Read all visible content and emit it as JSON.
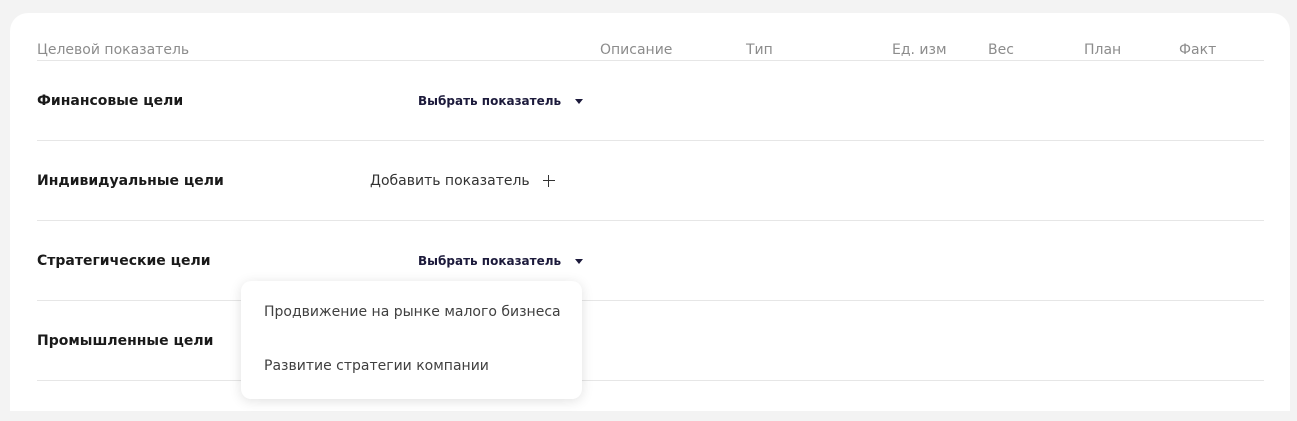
{
  "table": {
    "columns": {
      "indicator": "Целевой показатель",
      "description": "Описание",
      "type": "Тип",
      "unit": "Ед. изм",
      "weight": "Вес",
      "plan": "План",
      "fact": "Факт"
    },
    "rows": [
      {
        "title": "Финансовые цели",
        "action": "Выбрать показатель"
      },
      {
        "title": "Индивидуальные цели",
        "action": "Добавить показатель"
      },
      {
        "title": "Стратегические цели",
        "action": "Выбрать показатель"
      },
      {
        "title": "Промышленные цели"
      }
    ]
  },
  "dropdown": {
    "options": [
      "Продвижение на рынке малого бизнеса",
      "Развитие стратегии компании"
    ]
  }
}
